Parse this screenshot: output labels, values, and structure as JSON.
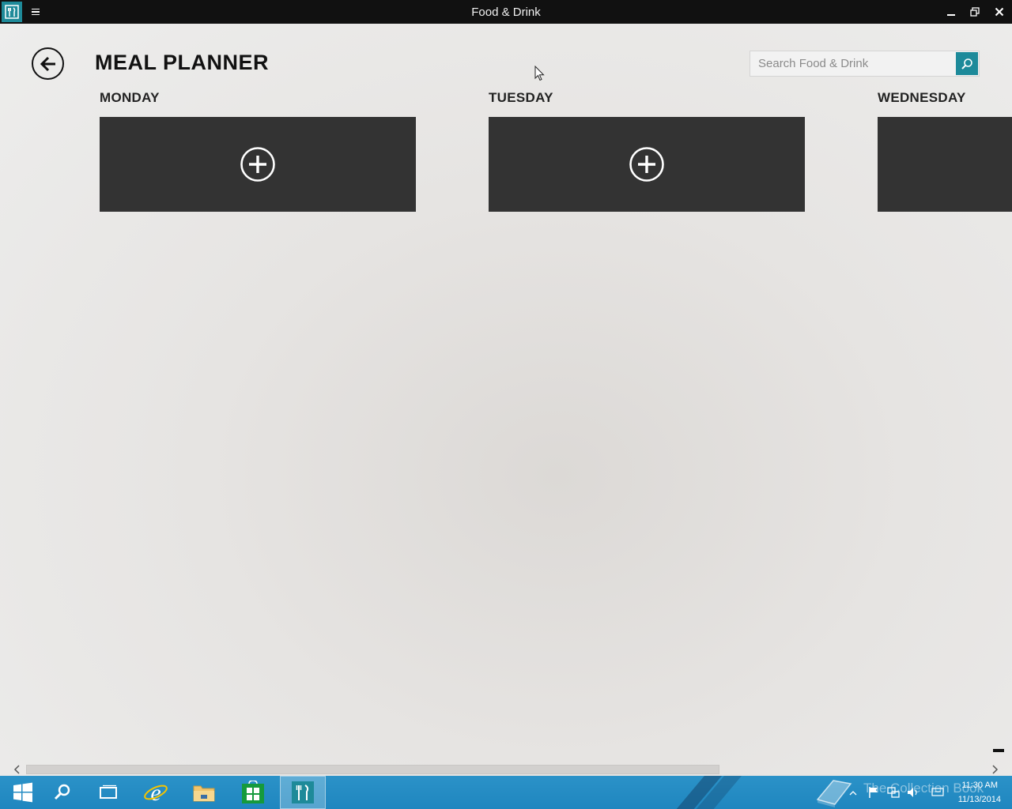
{
  "window": {
    "title": "Food & Drink"
  },
  "page": {
    "title": "MEAL PLANNER"
  },
  "search": {
    "placeholder": "Search Food & Drink"
  },
  "days": [
    {
      "label": "MONDAY"
    },
    {
      "label": "TUESDAY"
    },
    {
      "label": "WEDNESDAY"
    }
  ],
  "taskbar": {
    "watermark": "The Collection Book",
    "time": "11:30 AM",
    "date": "11/13/2014"
  },
  "colors": {
    "accent": "#1d8a9a",
    "tile": "#333333",
    "taskbar": "#2289c1"
  }
}
